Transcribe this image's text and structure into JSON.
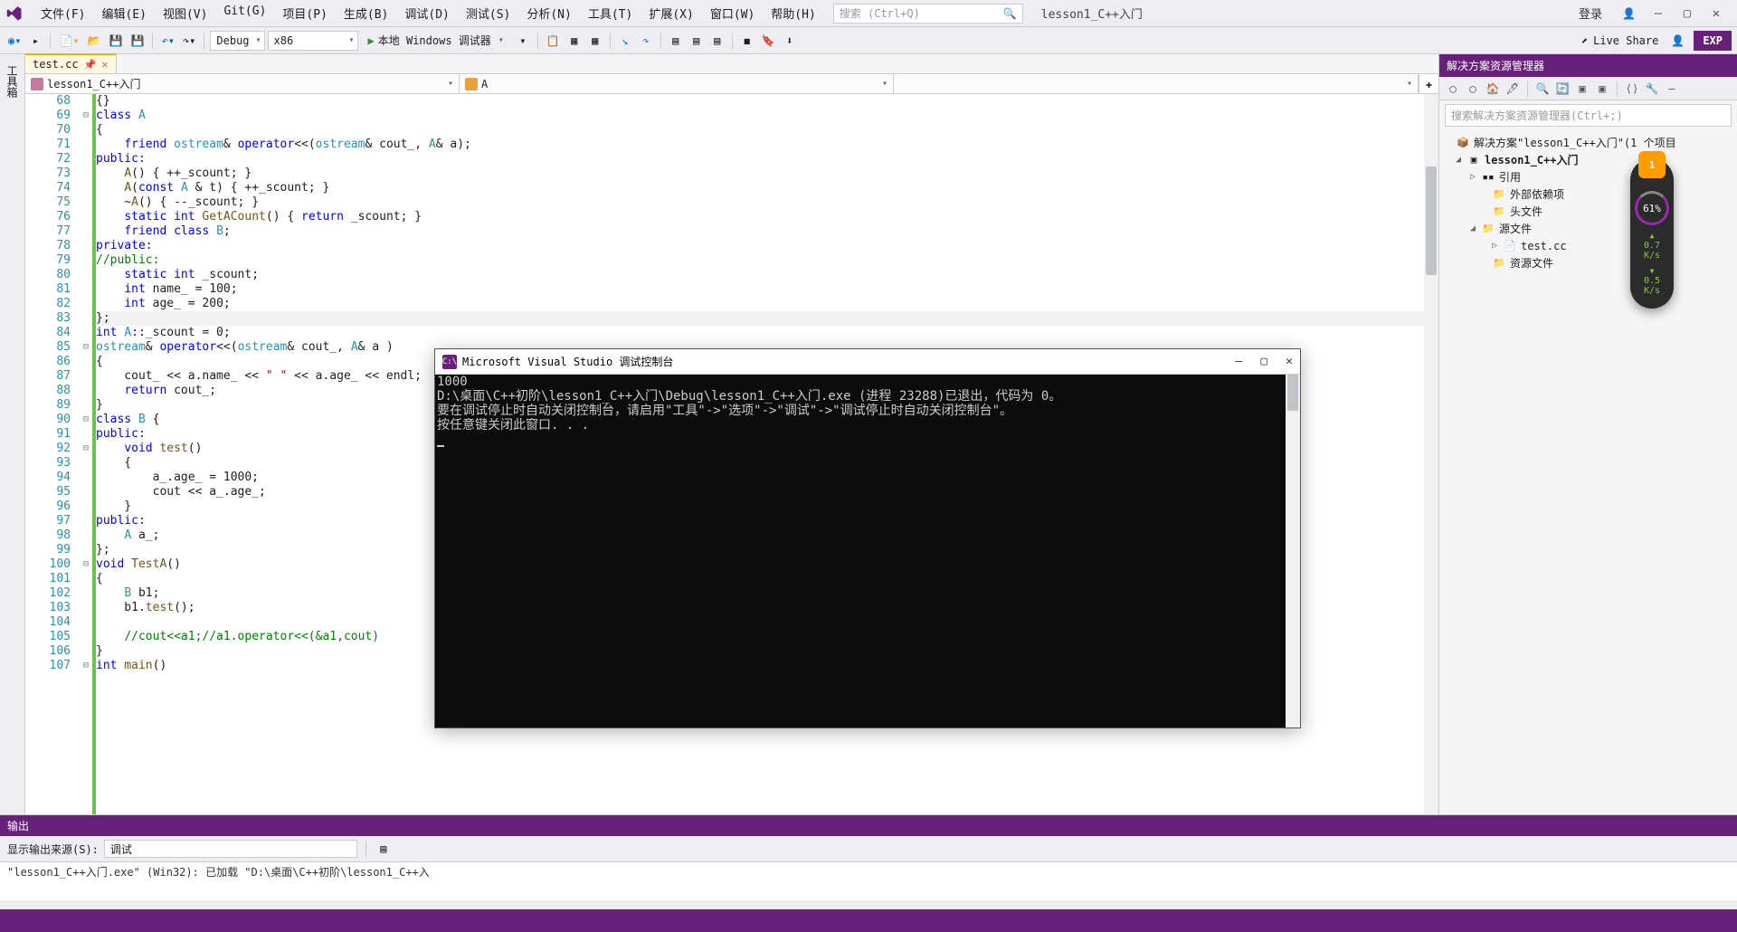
{
  "menubar": {
    "items": [
      "文件(F)",
      "编辑(E)",
      "视图(V)",
      "Git(G)",
      "项目(P)",
      "生成(B)",
      "调试(D)",
      "测试(S)",
      "分析(N)",
      "工具(T)",
      "扩展(X)",
      "窗口(W)",
      "帮助(H)"
    ],
    "search_placeholder": "搜索 (Ctrl+Q)",
    "solution_label": "lesson1_C++入门",
    "login": "登录"
  },
  "toolbar": {
    "config": "Debug",
    "platform": "x86",
    "start_label": "本地 Windows 调试器",
    "live_share": "Live Share",
    "exp": "EXP"
  },
  "editor": {
    "tab_name": "test.cc",
    "nav_project": "lesson1_C++入门",
    "nav_scope": "A",
    "first_line": 68,
    "lines": [
      {
        "n": 68,
        "f": "",
        "h": "{}"
      },
      {
        "n": 69,
        "f": "⊟",
        "h": "<span class='kw'>class</span> <span class='typ'>A</span>"
      },
      {
        "n": 70,
        "f": "",
        "h": "{"
      },
      {
        "n": 71,
        "f": "",
        "h": "    <span class='kw'>friend</span> <span class='typ'>ostream</span>&amp; <span class='kw'>operator</span>&lt;&lt;(<span class='typ'>ostream</span>&amp; cout_, <span class='typ'>A</span>&amp; a);"
      },
      {
        "n": 72,
        "f": "",
        "h": "<span class='kw'>public</span>:"
      },
      {
        "n": 73,
        "f": "",
        "h": "    <span class='fn'>A</span>() { ++_scount; }"
      },
      {
        "n": 74,
        "f": "",
        "h": "    <span class='fn'>A</span>(<span class='kw'>const</span> <span class='typ'>A</span> &amp; t) { ++_scount; }"
      },
      {
        "n": 75,
        "f": "",
        "h": "    ~<span class='fn'>A</span>() { --_scount; }"
      },
      {
        "n": 76,
        "f": "",
        "h": "    <span class='kw'>static</span> <span class='kw'>int</span> <span class='fn'>GetACount</span>() { <span class='kw'>return</span> _scount; }"
      },
      {
        "n": 77,
        "f": "",
        "h": "    <span class='kw'>friend</span> <span class='kw'>class</span> <span class='typ'>B</span>;"
      },
      {
        "n": 78,
        "f": "",
        "h": "<span class='kw'>private</span>:"
      },
      {
        "n": 79,
        "f": "",
        "h": "<span class='cmt'>//public:</span>"
      },
      {
        "n": 80,
        "f": "",
        "h": "    <span class='kw'>static</span> <span class='kw'>int</span> _scount;"
      },
      {
        "n": 81,
        "f": "",
        "h": "    <span class='kw'>int</span> name_ = 100;"
      },
      {
        "n": 82,
        "f": "",
        "h": "    <span class='kw'>int</span> age_ = 200;"
      },
      {
        "n": 83,
        "f": "",
        "h": "};",
        "cls": "cursor-line"
      },
      {
        "n": 84,
        "f": "",
        "h": "<span class='kw'>int</span> <span class='typ'>A</span>::_scount = 0;"
      },
      {
        "n": 85,
        "f": "⊟",
        "h": "<span class='typ'>ostream</span>&amp; <span class='kw'>operator</span>&lt;&lt;(<span class='typ'>ostream</span>&amp; cout_, <span class='typ'>A</span>&amp; a )"
      },
      {
        "n": 86,
        "f": "",
        "h": "{"
      },
      {
        "n": 87,
        "f": "",
        "h": "    cout_ &lt;&lt; a.name_ &lt;&lt; <span class='str'>\" \"</span> &lt;&lt; a.age_ &lt;&lt; endl;"
      },
      {
        "n": 88,
        "f": "",
        "h": "    <span class='kw'>return</span> cout_;"
      },
      {
        "n": 89,
        "f": "",
        "h": "}"
      },
      {
        "n": 90,
        "f": "⊟",
        "h": "<span class='kw'>class</span> <span class='typ'>B</span> {"
      },
      {
        "n": 91,
        "f": "",
        "h": "<span class='kw'>public</span>:"
      },
      {
        "n": 92,
        "f": "⊟",
        "h": "    <span class='kw'>void</span> <span class='fn'>test</span>()"
      },
      {
        "n": 93,
        "f": "",
        "h": "    {"
      },
      {
        "n": 94,
        "f": "",
        "h": "        a_.age_ = 1000;"
      },
      {
        "n": 95,
        "f": "",
        "h": "        cout &lt;&lt; a_.age_;"
      },
      {
        "n": 96,
        "f": "",
        "h": "    }"
      },
      {
        "n": 97,
        "f": "",
        "h": "<span class='kw'>public</span>:"
      },
      {
        "n": 98,
        "f": "",
        "h": "    <span class='typ'>A</span> a_;"
      },
      {
        "n": 99,
        "f": "",
        "h": "};"
      },
      {
        "n": 100,
        "f": "⊟",
        "h": "<span class='kw'>void</span> <span class='fn'>TestA</span>()"
      },
      {
        "n": 101,
        "f": "",
        "h": "{"
      },
      {
        "n": 102,
        "f": "",
        "h": "    <span class='typ'>B</span> b1;"
      },
      {
        "n": 103,
        "f": "",
        "h": "    b1.<span class='fn'>test</span>();"
      },
      {
        "n": 104,
        "f": "",
        "h": ""
      },
      {
        "n": 105,
        "f": "",
        "h": "    <span class='cmt'>//cout&lt;&lt;a1;//a1.operator&lt;&lt;(&amp;a1,cout)</span>"
      },
      {
        "n": 106,
        "f": "",
        "h": "}"
      },
      {
        "n": 107,
        "f": "⊟",
        "h": "<span class='kw'>int</span> <span class='fn'>main</span>()"
      }
    ]
  },
  "solution_explorer": {
    "title": "解决方案资源管理器",
    "search_placeholder": "搜索解决方案资源管理器(Ctrl+;)",
    "solution_line": "解决方案\"lesson1_C++入门\"(1 个项目",
    "project": "lesson1_C++入门",
    "refs": "引用",
    "external": "外部依赖项",
    "headers": "头文件",
    "sources": "源文件",
    "file1": "test.cc",
    "resources": "资源文件"
  },
  "output": {
    "title": "输出",
    "from_label": "显示输出来源(S):",
    "from_value": "调试",
    "body": "\"lesson1_C++入门.exe\" (Win32): 已加载 \"D:\\桌面\\C++初阶\\lesson1_C++入"
  },
  "console": {
    "title": "Microsoft Visual Studio 调试控制台",
    "lines": [
      "1000",
      "D:\\桌面\\C++初阶\\lesson1_C++入门\\Debug\\lesson1_C++入门.exe (进程 23288)已退出，代码为 0。",
      "要在调试停止时自动关闭控制台，请启用\"工具\"->\"选项\"->\"调试\"->\"调试停止时自动关闭控制台\"。",
      "按任意键关闭此窗口. . ."
    ]
  },
  "badge": {
    "shield": "1",
    "pct": "61%",
    "up": "0.7",
    "up_unit": "K/s",
    "dn": "0.5",
    "dn_unit": "K/s"
  }
}
